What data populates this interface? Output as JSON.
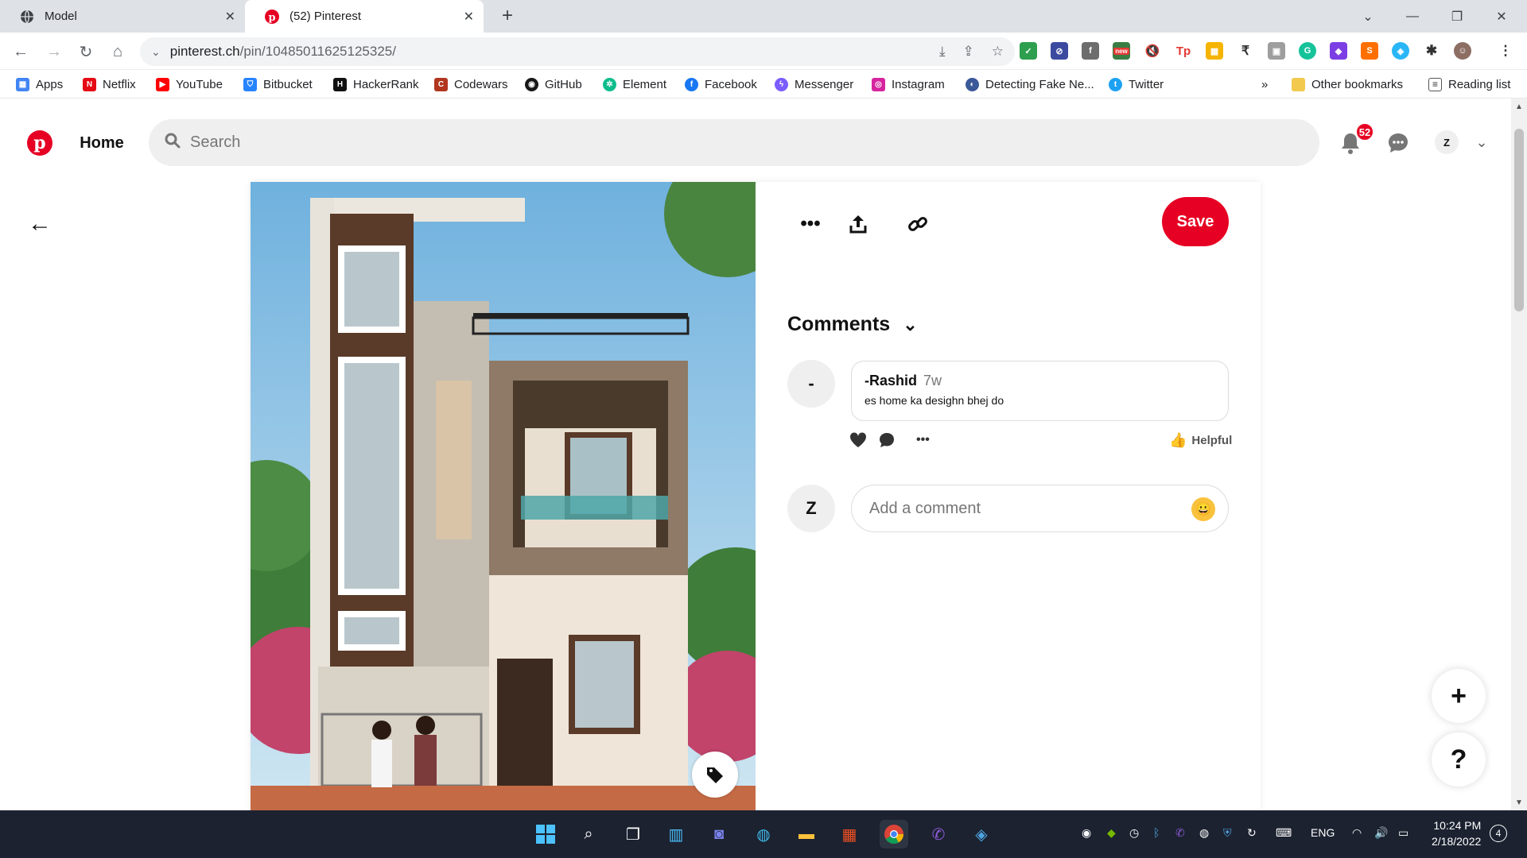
{
  "browser": {
    "tabs": [
      {
        "title": "Model",
        "icon": "globe-icon"
      },
      {
        "title": "(52) Pinterest",
        "icon": "pinterest-icon"
      }
    ],
    "url_host": "pinterest.ch",
    "url_path": "/pin/10485011625125325/",
    "extension_badge_new": "new",
    "bookmarks": [
      {
        "label": "Apps",
        "icon": "apps-grid-icon",
        "color": "#4285f4"
      },
      {
        "label": "Netflix",
        "icon": "netflix-icon",
        "color": "#e50914"
      },
      {
        "label": "YouTube",
        "icon": "youtube-icon",
        "color": "#ff0000"
      },
      {
        "label": "Bitbucket",
        "icon": "bitbucket-icon",
        "color": "#2684ff"
      },
      {
        "label": "HackerRank",
        "icon": "hackerrank-icon",
        "color": "#111111"
      },
      {
        "label": "Codewars",
        "icon": "codewars-icon",
        "color": "#b1361e"
      },
      {
        "label": "GitHub",
        "icon": "github-icon",
        "color": "#181717"
      },
      {
        "label": "Element",
        "icon": "element-icon",
        "color": "#0dbd8b"
      },
      {
        "label": "Facebook",
        "icon": "facebook-icon",
        "color": "#1877f2"
      },
      {
        "label": "Messenger",
        "icon": "messenger-icon",
        "color": "#7a5cff"
      },
      {
        "label": "Instagram",
        "icon": "instagram-icon",
        "color": "#d6249f"
      },
      {
        "label": "Detecting Fake Ne...",
        "icon": "site-icon",
        "color": "#3b5998"
      },
      {
        "label": "Twitter",
        "icon": "twitter-icon",
        "color": "#1da1f2"
      }
    ],
    "bookmarks_overflow": "»",
    "other_bookmarks": "Other bookmarks",
    "reading_list": "Reading list"
  },
  "pinterest": {
    "home_label": "Home",
    "search_placeholder": "Search",
    "notification_count": "52",
    "user_initial": "Z",
    "save_label": "Save",
    "comments_title": "Comments",
    "comment": {
      "avatar_initial": "-",
      "author": "-Rashid",
      "age": "7w",
      "text": "es home ka desighn bhej do",
      "helpful_label": "Helpful"
    },
    "my_initial": "Z",
    "add_comment_placeholder": "Add a comment",
    "fab_plus": "+",
    "fab_help": "?",
    "brand_color": "#e60023"
  },
  "taskbar": {
    "language": "ENG",
    "time": "10:24 PM",
    "date": "2/18/2022",
    "notifications": "4"
  }
}
